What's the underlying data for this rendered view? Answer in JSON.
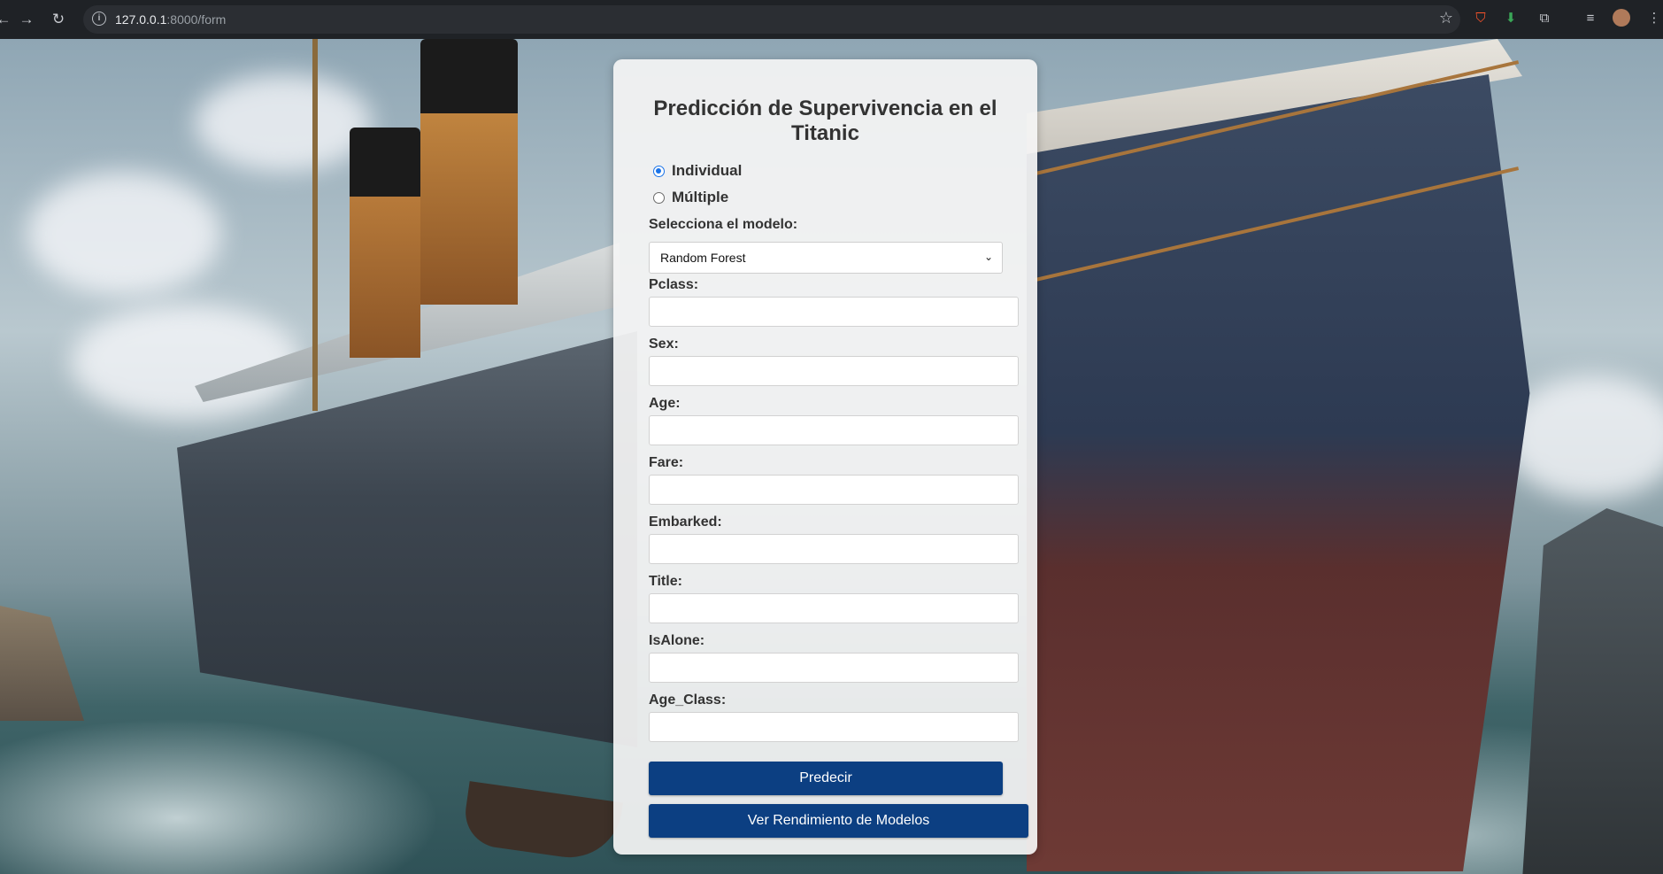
{
  "browser": {
    "url_host": "127.0.0.1",
    "url_path": ":8000/form"
  },
  "form": {
    "title_line1": "Predicción de Supervivencia en el",
    "title_line2": "Titanic",
    "mode_options": [
      {
        "label": "Individual",
        "checked": true
      },
      {
        "label": "Múltiple",
        "checked": false
      }
    ],
    "model_label": "Selecciona el modelo:",
    "model_selected": "Random Forest",
    "fields": [
      {
        "label": "Pclass:",
        "value": ""
      },
      {
        "label": "Sex:",
        "value": ""
      },
      {
        "label": "Age:",
        "value": ""
      },
      {
        "label": "Fare:",
        "value": ""
      },
      {
        "label": "Embarked:",
        "value": ""
      },
      {
        "label": "Title:",
        "value": ""
      },
      {
        "label": "IsAlone:",
        "value": ""
      },
      {
        "label": "Age_Class:",
        "value": ""
      }
    ],
    "predict_button": "Predecir",
    "performance_button": "Ver Rendimiento de Modelos"
  },
  "colors": {
    "primary_button": "#0c3f82",
    "radio_accent": "#1a73e8"
  }
}
